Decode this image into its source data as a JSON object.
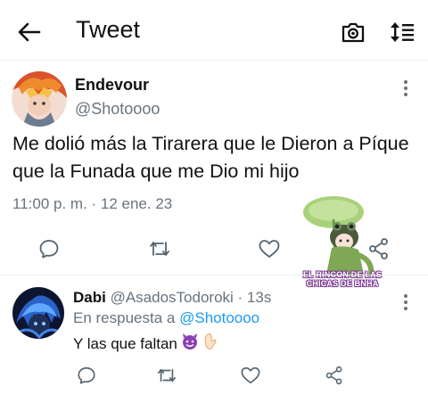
{
  "header": {
    "title": "Tweet",
    "back_icon": "arrow-left-icon",
    "camera_icon": "camera-icon",
    "sort_icon": "sort-icon"
  },
  "tweet": {
    "author_name": "Endevour",
    "author_handle": "@Shotoooo",
    "text": "Me dolió más la Tirarera que le Dieron a Píque que la Funada que me Dio mi hijo",
    "timestamp": "11:00 p. m. · 12 ene. 23",
    "actions": [
      "reply-icon",
      "retweet-icon",
      "like-icon",
      "share-icon"
    ]
  },
  "sticker": {
    "text": "EL RINCON DE LAS CHICAS DE BNHA"
  },
  "reply": {
    "author_name": "Dabi",
    "author_handle": "@AsadosTodoroki",
    "time": "· 13s",
    "reply_to_label": "En respuesta a",
    "reply_to_handle": "@Shotoooo",
    "text": "Y las que faltan",
    "emojis": [
      "smiling-devil-emoji",
      "pinched-fingers-emoji"
    ],
    "actions": [
      "reply-icon",
      "retweet-icon",
      "like-icon",
      "share-icon"
    ]
  },
  "colors": {
    "text": "#0f1419",
    "secondary": "#68737d",
    "accent": "#1d9bf0",
    "divider": "#eceff1"
  }
}
